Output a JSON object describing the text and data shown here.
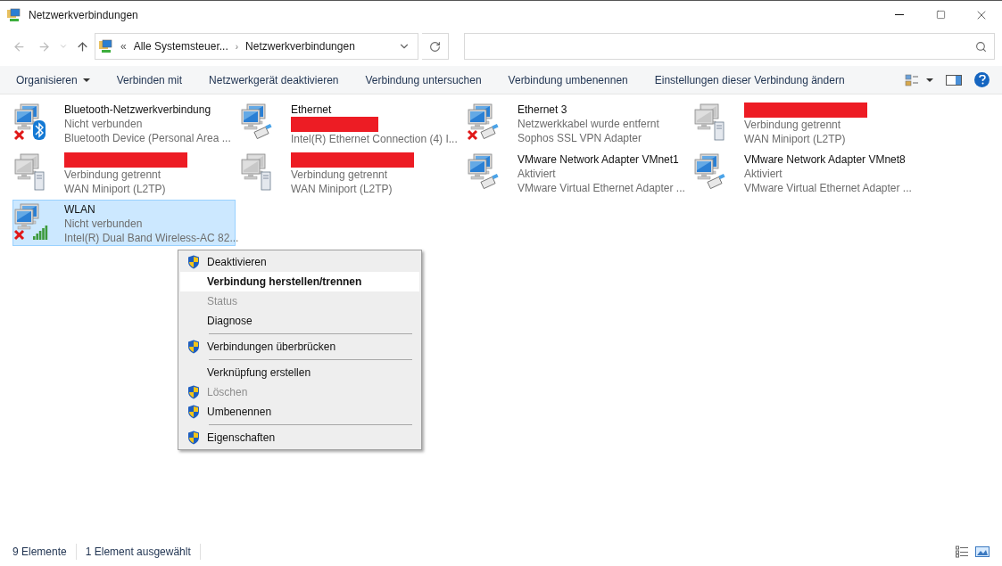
{
  "window": {
    "title": "Netzwerkverbindungen"
  },
  "address_bar": {
    "overflow": "«",
    "separator": "›",
    "segments": [
      "Alle Systemsteuer...",
      "Netzwerkverbindungen"
    ]
  },
  "command_bar": [
    {
      "label": "Organisieren",
      "dropdown": true
    },
    {
      "label": "Verbinden mit",
      "dropdown": false
    },
    {
      "label": "Netzwerkgerät deaktivieren",
      "dropdown": false
    },
    {
      "label": "Verbindung untersuchen",
      "dropdown": false
    },
    {
      "label": "Verbindung umbenennen",
      "dropdown": false
    },
    {
      "label": "Einstellungen dieser Verbindung ändern",
      "dropdown": false
    }
  ],
  "connections": [
    {
      "selected": false,
      "enabled": true,
      "disconnected": true,
      "kind": "bluetooth",
      "lines": [
        {
          "kind": "text",
          "text": "Bluetooth-Netzwerkverbindung"
        },
        {
          "kind": "text",
          "text": "Nicht verbunden"
        },
        {
          "kind": "text",
          "text": "Bluetooth Device (Personal Area ..."
        }
      ]
    },
    {
      "selected": false,
      "enabled": true,
      "disconnected": false,
      "kind": "cable",
      "lines": [
        {
          "kind": "text",
          "text": "Ethernet"
        },
        {
          "kind": "redacted"
        },
        {
          "kind": "text",
          "text": "Intel(R) Ethernet Connection (4) I..."
        }
      ]
    },
    {
      "selected": false,
      "enabled": true,
      "disconnected": true,
      "kind": "cable",
      "lines": [
        {
          "kind": "text",
          "text": "Ethernet 3"
        },
        {
          "kind": "text",
          "text": "Netzwerkkabel wurde entfernt"
        },
        {
          "kind": "text",
          "text": "Sophos SSL VPN Adapter"
        }
      ]
    },
    {
      "selected": false,
      "enabled": false,
      "disconnected": false,
      "kind": "server",
      "lines": [
        {
          "kind": "redacted"
        },
        {
          "kind": "text",
          "text": "Verbindung getrennt"
        },
        {
          "kind": "text",
          "text": "WAN Miniport (L2TP)"
        }
      ]
    },
    {
      "selected": false,
      "enabled": false,
      "disconnected": false,
      "kind": "server",
      "lines": [
        {
          "kind": "redacted"
        },
        {
          "kind": "text",
          "text": "Verbindung getrennt"
        },
        {
          "kind": "text",
          "text": "WAN Miniport (L2TP)"
        }
      ]
    },
    {
      "selected": false,
      "enabled": false,
      "disconnected": false,
      "kind": "server",
      "lines": [
        {
          "kind": "redacted"
        },
        {
          "kind": "text",
          "text": "Verbindung getrennt"
        },
        {
          "kind": "text",
          "text": "WAN Miniport (L2TP)"
        }
      ]
    },
    {
      "selected": false,
      "enabled": true,
      "disconnected": false,
      "kind": "cable",
      "lines": [
        {
          "kind": "text",
          "text": "VMware Network Adapter VMnet1"
        },
        {
          "kind": "text",
          "text": "Aktiviert"
        },
        {
          "kind": "text",
          "text": "VMware Virtual Ethernet Adapter ..."
        }
      ]
    },
    {
      "selected": false,
      "enabled": true,
      "disconnected": false,
      "kind": "cable",
      "lines": [
        {
          "kind": "text",
          "text": "VMware Network Adapter VMnet8"
        },
        {
          "kind": "text",
          "text": "Aktiviert"
        },
        {
          "kind": "text",
          "text": "VMware Virtual Ethernet Adapter ..."
        }
      ]
    },
    {
      "selected": true,
      "enabled": true,
      "disconnected": true,
      "kind": "signal",
      "lines": [
        {
          "kind": "text",
          "text": "WLAN"
        },
        {
          "kind": "text",
          "text": "Nicht verbunden"
        },
        {
          "kind": "text",
          "text": "Intel(R) Dual Band Wireless-AC 82..."
        }
      ]
    }
  ],
  "context_menu": [
    {
      "kind": "item",
      "label": "Deaktivieren",
      "shield": true,
      "disabled": false,
      "default": false,
      "selected": false
    },
    {
      "kind": "item",
      "label": "Verbindung herstellen/trennen",
      "shield": false,
      "disabled": false,
      "default": true,
      "selected": true
    },
    {
      "kind": "item",
      "label": "Status",
      "shield": false,
      "disabled": true,
      "default": false,
      "selected": false
    },
    {
      "kind": "item",
      "label": "Diagnose",
      "shield": false,
      "disabled": false,
      "default": false,
      "selected": false
    },
    {
      "kind": "separator"
    },
    {
      "kind": "item",
      "label": "Verbindungen überbrücken",
      "shield": true,
      "disabled": false,
      "default": false,
      "selected": false
    },
    {
      "kind": "separator"
    },
    {
      "kind": "item",
      "label": "Verknüpfung erstellen",
      "shield": false,
      "disabled": false,
      "default": false,
      "selected": false
    },
    {
      "kind": "item",
      "label": "Löschen",
      "shield": true,
      "disabled": true,
      "default": false,
      "selected": false
    },
    {
      "kind": "item",
      "label": "Umbenennen",
      "shield": true,
      "disabled": false,
      "default": false,
      "selected": false
    },
    {
      "kind": "separator"
    },
    {
      "kind": "item",
      "label": "Eigenschaften",
      "shield": true,
      "disabled": false,
      "default": false,
      "selected": false
    }
  ],
  "status_bar": {
    "count": "9 Elemente",
    "selection": "1 Element ausgewählt"
  }
}
